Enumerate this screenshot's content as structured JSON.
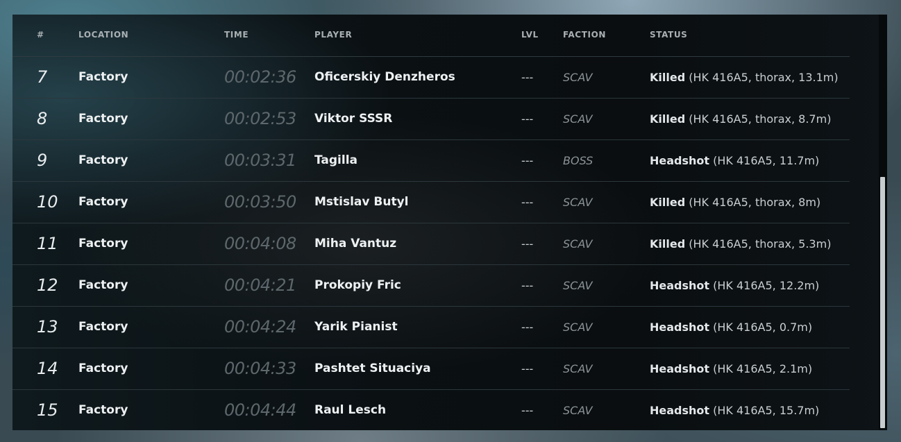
{
  "columns": {
    "num": "#",
    "location": "LOCATION",
    "time": "TIME",
    "player": "PLAYER",
    "lvl": "LVL",
    "faction": "FACTION",
    "status": "STATUS"
  },
  "rows": [
    {
      "num": "7",
      "location": "Factory",
      "time": "00:02:36",
      "player": "Oficerskiy Denzheros",
      "lvl": "---",
      "faction": "SCAV",
      "status_kind": "Killed",
      "status_detail": "(HK 416A5, thorax, 13.1m)"
    },
    {
      "num": "8",
      "location": "Factory",
      "time": "00:02:53",
      "player": "Viktor SSSR",
      "lvl": "---",
      "faction": "SCAV",
      "status_kind": "Killed",
      "status_detail": "(HK 416A5, thorax, 8.7m)"
    },
    {
      "num": "9",
      "location": "Factory",
      "time": "00:03:31",
      "player": "Tagilla",
      "lvl": "---",
      "faction": "BOSS",
      "status_kind": "Headshot",
      "status_detail": "(HK 416A5, 11.7m)"
    },
    {
      "num": "10",
      "location": "Factory",
      "time": "00:03:50",
      "player": "Mstislav Butyl",
      "lvl": "---",
      "faction": "SCAV",
      "status_kind": "Killed",
      "status_detail": "(HK 416A5, thorax, 8m)"
    },
    {
      "num": "11",
      "location": "Factory",
      "time": "00:04:08",
      "player": "Miha Vantuz",
      "lvl": "---",
      "faction": "SCAV",
      "status_kind": "Killed",
      "status_detail": "(HK 416A5, thorax, 5.3m)"
    },
    {
      "num": "12",
      "location": "Factory",
      "time": "00:04:21",
      "player": "Prokopiy Fric",
      "lvl": "---",
      "faction": "SCAV",
      "status_kind": "Headshot",
      "status_detail": "(HK 416A5, 12.2m)"
    },
    {
      "num": "13",
      "location": "Factory",
      "time": "00:04:24",
      "player": "Yarik Pianist",
      "lvl": "---",
      "faction": "SCAV",
      "status_kind": "Headshot",
      "status_detail": "(HK 416A5, 0.7m)"
    },
    {
      "num": "14",
      "location": "Factory",
      "time": "00:04:33",
      "player": "Pashtet Situaciya",
      "lvl": "---",
      "faction": "SCAV",
      "status_kind": "Headshot",
      "status_detail": "(HK 416A5, 2.1m)"
    },
    {
      "num": "15",
      "location": "Factory",
      "time": "00:04:44",
      "player": "Raul Lesch",
      "lvl": "---",
      "faction": "SCAV",
      "status_kind": "Headshot",
      "status_detail": "(HK 416A5, 15.7m)"
    }
  ],
  "scroll": {
    "position_fraction": 1.0
  }
}
